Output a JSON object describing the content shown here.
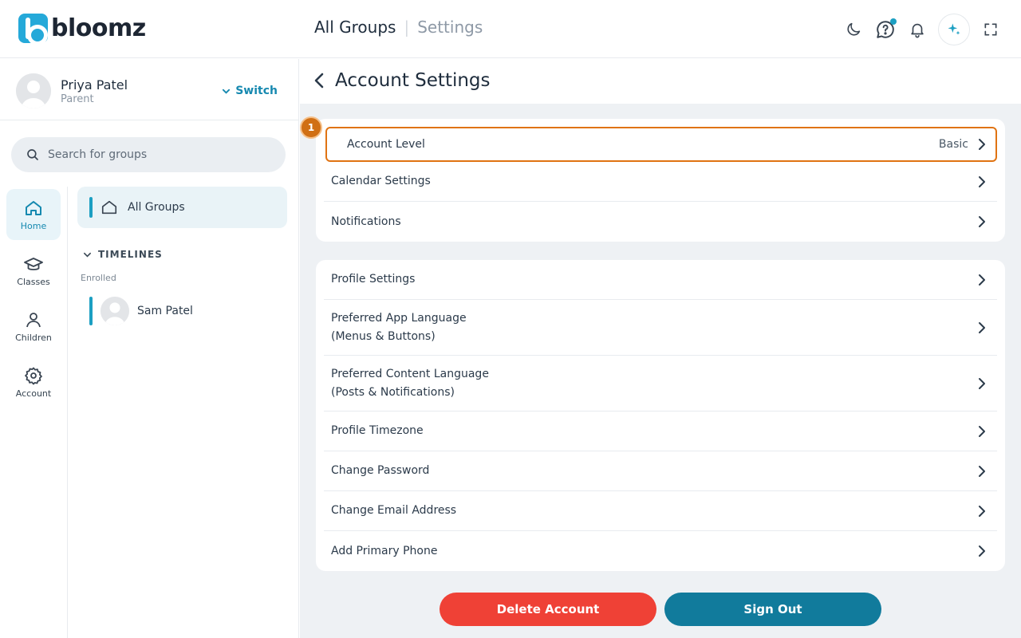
{
  "app": {
    "brand": "bloomz",
    "colors": {
      "accent": "#1c9fc2",
      "danger": "#ef4136",
      "primary": "#117b9c",
      "highlight": "#e07312"
    }
  },
  "header": {
    "title": "All Groups",
    "separator": "|",
    "subtitle": "Settings",
    "icons": [
      "moon-icon",
      "help-bubble-icon",
      "bell-icon",
      "sparkle-icon",
      "fullscreen-icon"
    ]
  },
  "profile": {
    "name": "Priya Patel",
    "role": "Parent",
    "switch_label": "Switch"
  },
  "search": {
    "placeholder": "Search for groups"
  },
  "rail": {
    "items": [
      {
        "label": "Home",
        "icon": "home-icon",
        "active": true
      },
      {
        "label": "Classes",
        "icon": "graduation-cap-icon",
        "active": false
      },
      {
        "label": "Children",
        "icon": "person-icon",
        "active": false
      },
      {
        "label": "Account",
        "icon": "gear-icon",
        "active": false
      }
    ]
  },
  "groups": {
    "all_groups_label": "All Groups",
    "timelines_label": "TIMELINES",
    "enrolled_label": "Enrolled",
    "children": [
      {
        "name": "Sam Patel"
      }
    ]
  },
  "main": {
    "title": "Account Settings",
    "badge": "1",
    "section1": [
      {
        "label": "Account Level",
        "value": "Basic"
      },
      {
        "label": "Calendar Settings"
      },
      {
        "label": "Notifications"
      }
    ],
    "section2": [
      {
        "label": "Profile Settings"
      },
      {
        "label": "Preferred App Language",
        "sub": "(Menus & Buttons)"
      },
      {
        "label": "Preferred Content Language",
        "sub": "(Posts & Notifications)"
      },
      {
        "label": "Profile Timezone"
      },
      {
        "label": "Change Password"
      },
      {
        "label": "Change Email Address"
      },
      {
        "label": "Add Primary Phone"
      }
    ],
    "delete_label": "Delete Account",
    "signout_label": "Sign Out"
  }
}
